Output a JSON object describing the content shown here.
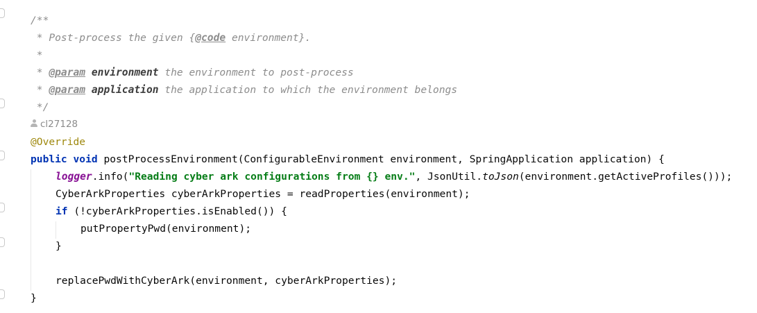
{
  "editor": {
    "javadoc": {
      "open": "/**",
      "line1_prefix": " * Post-process the given {",
      "line1_tag": "@code",
      "line1_suffix": " environment}.",
      "blank": " *",
      "param1_prefix": " * ",
      "param1_tag": "@param",
      "param1_name": "environment",
      "param1_desc": " the environment to post-process",
      "param2_prefix": " * ",
      "param2_tag": "@param",
      "param2_name": "application",
      "param2_desc": " the application to which the environment belongs",
      "close": " */"
    },
    "author_hint": "cl27128",
    "annotation": "@Override",
    "signature": {
      "kw_public": "public",
      "kw_void": "void",
      "rest": " postProcessEnvironment(ConfigurableEnvironment environment, SpringApplication application) {"
    },
    "logger_line": {
      "field": "logger",
      "call": ".info(",
      "string": "\"Reading cyber ark configurations from {} env.\"",
      "mid": ", JsonUtil.",
      "static_method": "toJson",
      "tail": "(environment.getActiveProfiles()));"
    },
    "props_line": "CyberArkProperties cyberArkProperties = readProperties(environment);",
    "if_line": {
      "kw_if": "if",
      "rest": " (!cyberArkProperties.isEnabled()) {"
    },
    "put_line": "putPropertyPwd(environment);",
    "close_if": "}",
    "replace_line": "replacePwdWithCyberArk(environment, cyberArkProperties);",
    "close_method": "}"
  }
}
